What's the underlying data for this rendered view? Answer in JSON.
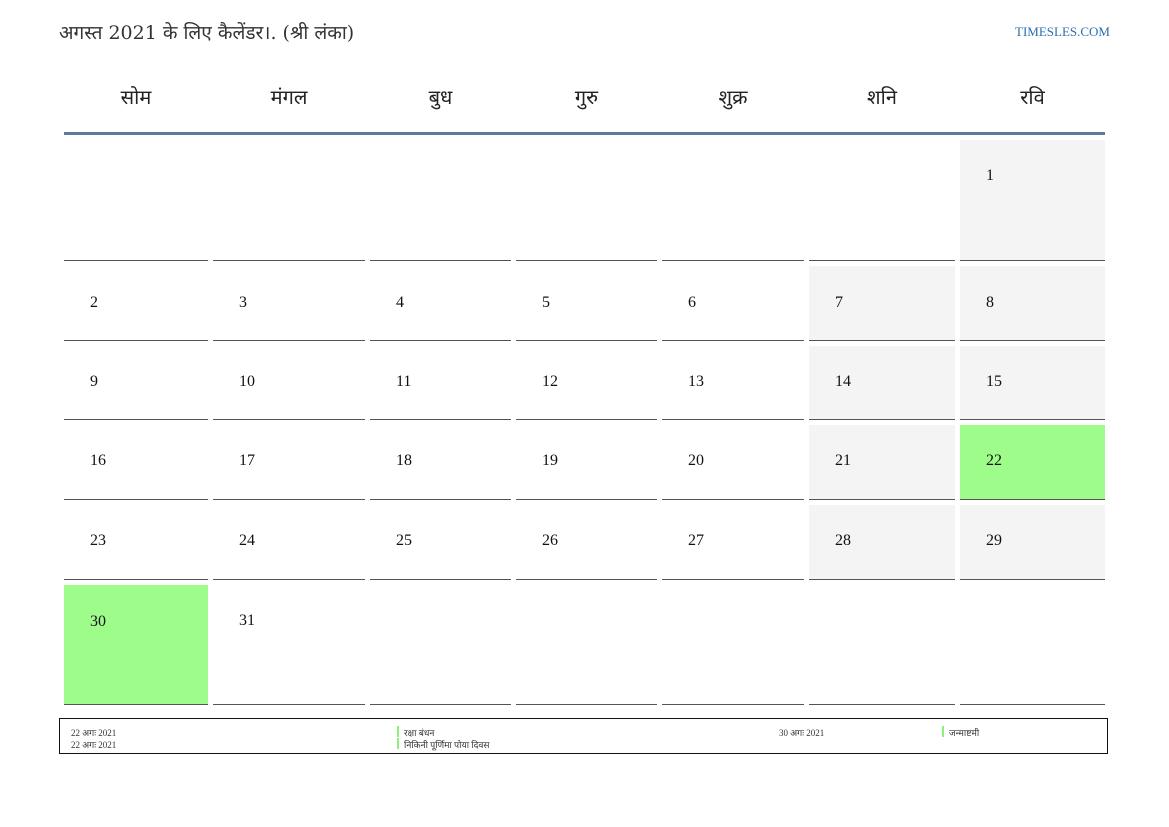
{
  "page": {
    "title": "अगस्त 2021 के लिए कैलेंडर।. (श्री लंका)",
    "brand": "TIMESLES.COM"
  },
  "colors": {
    "holiday": "#9dfc8a",
    "weekend": "#f4f4f4",
    "header_rule": "#5b7a9c",
    "brand": "#2a6fb0"
  },
  "weekdays": [
    "सोम",
    "मंगल",
    "बुध",
    "गुरु",
    "शुक्र",
    "शनि",
    "रवि"
  ],
  "weeks": [
    [
      "",
      "",
      "",
      "",
      "",
      "",
      "1"
    ],
    [
      "2",
      "3",
      "4",
      "5",
      "6",
      "7",
      "8"
    ],
    [
      "9",
      "10",
      "11",
      "12",
      "13",
      "14",
      "15"
    ],
    [
      "16",
      "17",
      "18",
      "19",
      "20",
      "21",
      "22"
    ],
    [
      "23",
      "24",
      "25",
      "26",
      "27",
      "28",
      "29"
    ],
    [
      "30",
      "31",
      "",
      "",
      "",
      "",
      ""
    ]
  ],
  "legend": [
    {
      "date": "22 अगः 2021",
      "name": "रक्षा बंधन"
    },
    {
      "date": "22 अगः 2021",
      "name": "निकिनी पूर्णिमा पोया दिवस"
    },
    {
      "date": "30 अगः 2021",
      "name": "जन्माष्टमी"
    }
  ]
}
